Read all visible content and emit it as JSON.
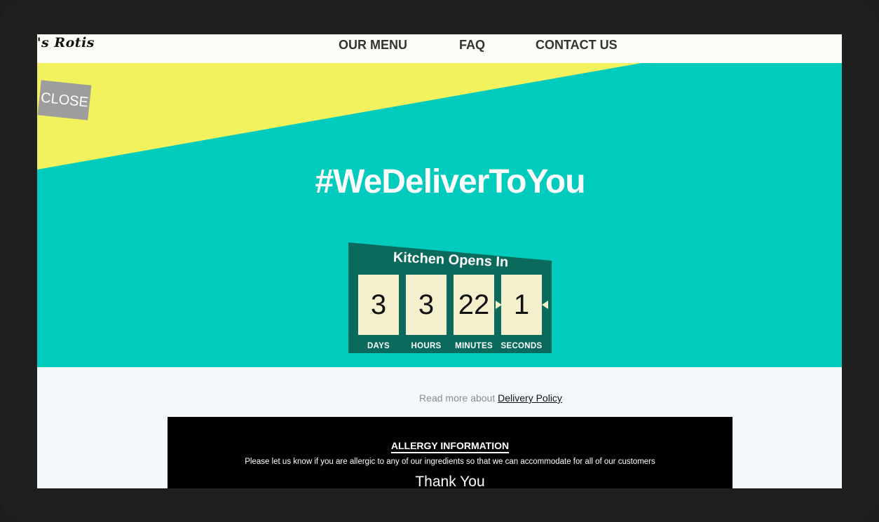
{
  "nav": {
    "logo_text": "i's Rotis",
    "links": [
      {
        "label": "OUR MENU"
      },
      {
        "label": "FAQ"
      },
      {
        "label": "CONTACT US"
      }
    ]
  },
  "hero": {
    "close_label": "CLOSE",
    "headline": "#WeDeliverToYou",
    "colors": {
      "teal": "#00cbbd",
      "yellow": "#f2f25e",
      "panel": "#0a6a5c"
    }
  },
  "countdown": {
    "title": "Kitchen Opens In",
    "units": [
      {
        "value": "3",
        "label": "DAYS"
      },
      {
        "value": "3",
        "label": "HOURS"
      },
      {
        "value": "22",
        "label": "MINUTES"
      },
      {
        "value": "1",
        "label": "SECONDS"
      }
    ]
  },
  "delivery": {
    "prefix": "Read more about",
    "link_label": "Delivery Policy"
  },
  "allergy": {
    "heading": "ALLERGY INFORMATION",
    "text": "Please let us know if you are allergic to any of our ingredients so that we can accommodate for all of our customers",
    "thanks": "Thank You"
  }
}
